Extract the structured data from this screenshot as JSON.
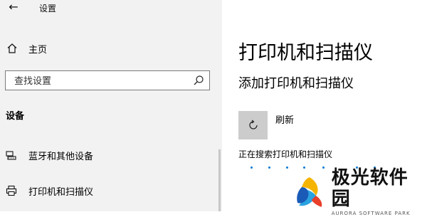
{
  "window": {
    "title": "设置",
    "back_glyph": "←"
  },
  "sidebar": {
    "home_label": "主页",
    "search_placeholder": "查找设置",
    "section_heading": "设备",
    "items": [
      {
        "label": "蓝牙和其他设备",
        "icon": "bluetooth-devices-icon"
      },
      {
        "label": "打印机和扫描仪",
        "icon": "printer-icon"
      }
    ]
  },
  "main": {
    "title": "打印机和扫描仪",
    "subtitle": "添加打印机和扫描仪",
    "refresh_label": "刷新",
    "searching_text": "正在搜索打印机和扫描仪"
  },
  "logo": {
    "cn": "极光软件园",
    "en": "AURORA SOFTWARE PARK"
  },
  "colors": {
    "sidebar_bg": "#f2f2f2",
    "accent": "#0078d7",
    "refresh_tile": "#cccccc"
  }
}
